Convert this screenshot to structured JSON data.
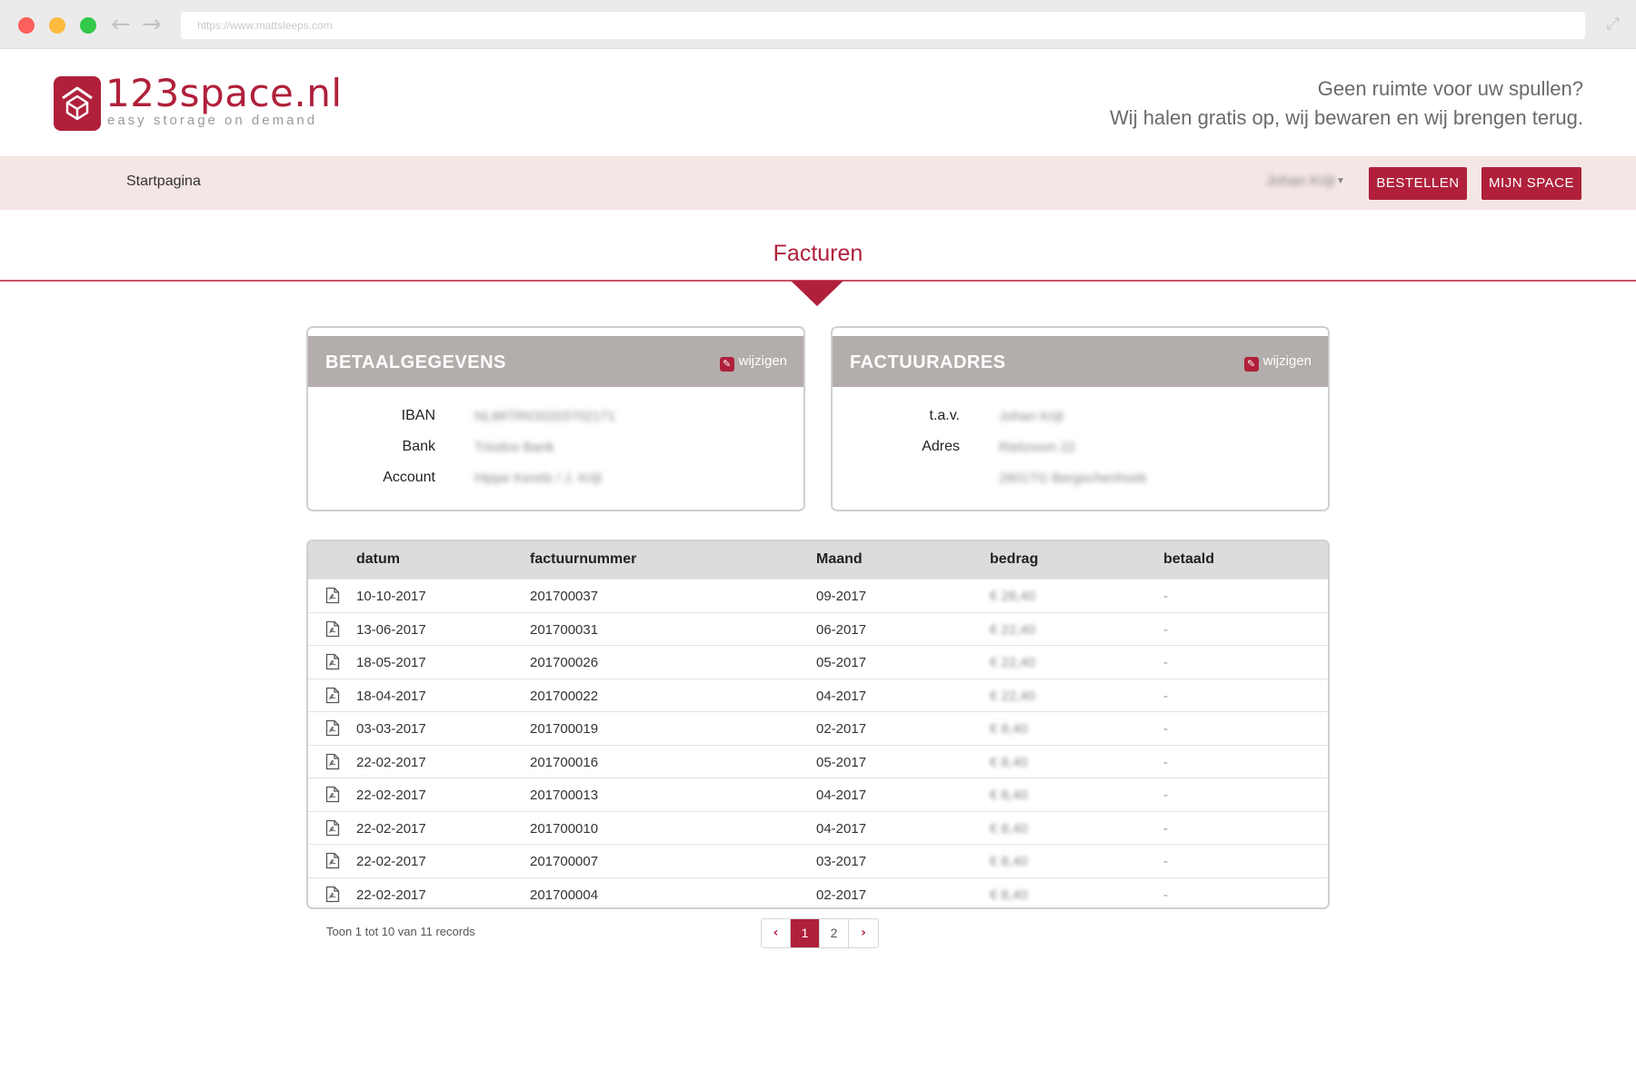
{
  "browser": {
    "url": "https://www.mattsleeps.com"
  },
  "brand": {
    "name": "123space.nl",
    "tagline": "easy storage on demand"
  },
  "slogan": {
    "line1": "Geen ruimte voor uw spullen?",
    "line2": "Wij halen gratis op, wij bewaren en wij brengen terug."
  },
  "nav": {
    "home": "Startpagina",
    "user": "Johan Krijt",
    "order_button": "BESTELLEN",
    "myspace_button": "MIJN SPACE"
  },
  "page": {
    "title": "Facturen"
  },
  "payment": {
    "title": "BETAALGEGEVENS",
    "edit": "wijzigen",
    "fields": [
      {
        "label": "IBAN",
        "value": "NL86TRIO0203702171"
      },
      {
        "label": "Bank",
        "value": "Triodos Bank"
      },
      {
        "label": "Account",
        "value": "Hippe Kerels / J. Krijt"
      }
    ]
  },
  "billing": {
    "title": "FACTUURADRES",
    "edit": "wijzigen",
    "fields": [
      {
        "label": "t.a.v.",
        "value": "Johan Krijt"
      },
      {
        "label": "Adres",
        "value": "Rietzoom 22"
      },
      {
        "label": "",
        "value": "2601TG Bergschenhoek"
      }
    ]
  },
  "table": {
    "headers": [
      "datum",
      "factuurnummer",
      "Maand",
      "bedrag",
      "betaald"
    ],
    "rows": [
      {
        "datum": "10-10-2017",
        "nummer": "201700037",
        "maand": "09-2017",
        "bedrag": "€ 28,40",
        "betaald": "-"
      },
      {
        "datum": "13-06-2017",
        "nummer": "201700031",
        "maand": "06-2017",
        "bedrag": "€ 22,40",
        "betaald": "-"
      },
      {
        "datum": "18-05-2017",
        "nummer": "201700026",
        "maand": "05-2017",
        "bedrag": "€ 22,40",
        "betaald": "-"
      },
      {
        "datum": "18-04-2017",
        "nummer": "201700022",
        "maand": "04-2017",
        "bedrag": "€ 22,40",
        "betaald": "-"
      },
      {
        "datum": "03-03-2017",
        "nummer": "201700019",
        "maand": "02-2017",
        "bedrag": "€ 8,40",
        "betaald": "-"
      },
      {
        "datum": "22-02-2017",
        "nummer": "201700016",
        "maand": "05-2017",
        "bedrag": "€ 8,40",
        "betaald": "-"
      },
      {
        "datum": "22-02-2017",
        "nummer": "201700013",
        "maand": "04-2017",
        "bedrag": "€ 8,40",
        "betaald": "-"
      },
      {
        "datum": "22-02-2017",
        "nummer": "201700010",
        "maand": "04-2017",
        "bedrag": "€ 8,40",
        "betaald": "-"
      },
      {
        "datum": "22-02-2017",
        "nummer": "201700007",
        "maand": "03-2017",
        "bedrag": "€ 8,40",
        "betaald": "-"
      },
      {
        "datum": "22-02-2017",
        "nummer": "201700004",
        "maand": "02-2017",
        "bedrag": "€ 8,40",
        "betaald": "-"
      }
    ]
  },
  "footer": {
    "records": "Toon 1 tot 10 van 11 records",
    "pages": [
      "1",
      "2"
    ],
    "prev": "‹",
    "next": "›"
  },
  "colors": {
    "brand": "#b0203b",
    "nav_bg": "#f4e6e5",
    "card_head": "#b3adab"
  },
  "icons": {
    "edit": "pencil-icon",
    "invoice": "pdf-file-icon",
    "back": "arrow-left-icon",
    "forward": "arrow-right-icon",
    "expand": "expand-icon"
  }
}
